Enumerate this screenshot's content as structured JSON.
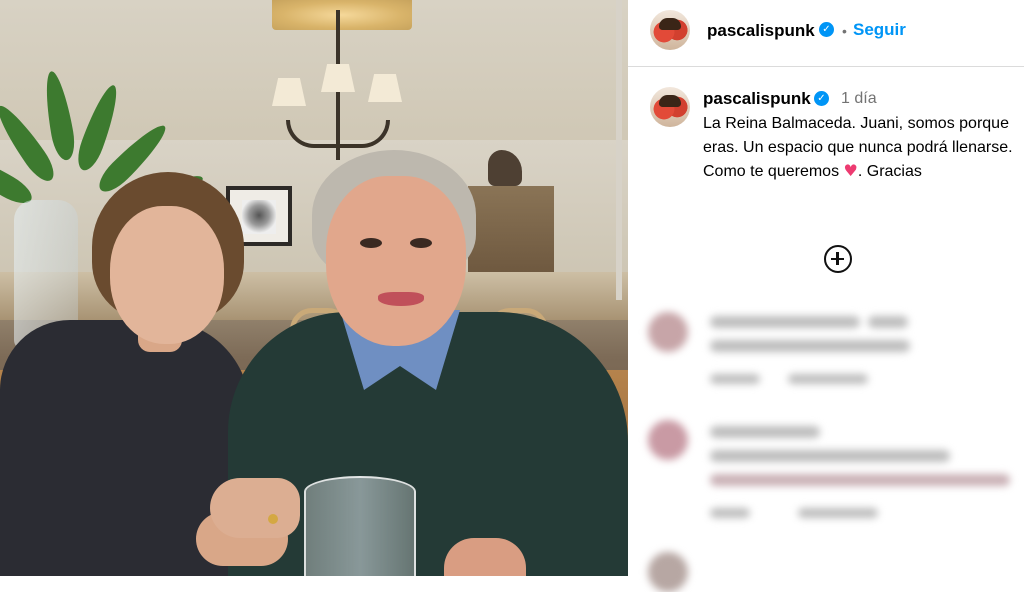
{
  "post": {
    "username": "pascalispunk",
    "verified_glyph": "✓",
    "separator": "•",
    "follow_label": "Seguir",
    "more_icon": "more-options-icon"
  },
  "caption": {
    "username": "pascalispunk",
    "time": "1 día",
    "text_before_emoji": "La Reina Balmaceda. Juani, somos porque eras. Un espacio que nunca podrá llenarse. Como te queremos ",
    "emoji": "♥",
    "text_after_emoji": ". Gracias"
  },
  "load_more_icon": "plus-circle-icon",
  "colors": {
    "accent": "#0095f6",
    "heart": "#ed3b71",
    "muted": "#737373",
    "divider": "#dbdbdb"
  }
}
